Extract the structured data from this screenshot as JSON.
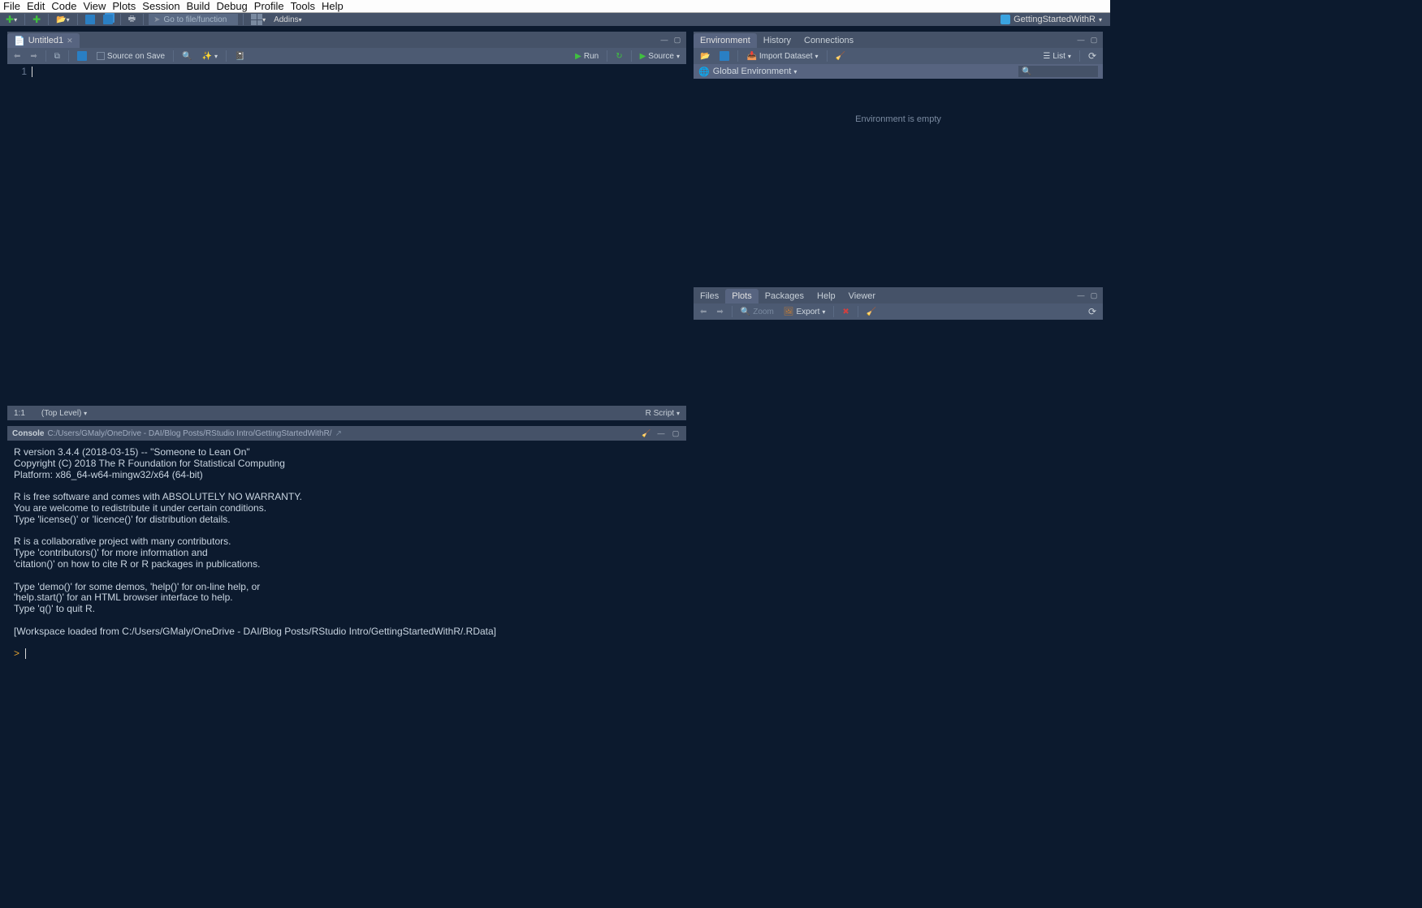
{
  "menubar": [
    "File",
    "Edit",
    "Code",
    "View",
    "Plots",
    "Session",
    "Build",
    "Debug",
    "Profile",
    "Tools",
    "Help"
  ],
  "toolbar": {
    "gofn": "Go to file/function",
    "addins": "Addins",
    "project": "GettingStartedWithR"
  },
  "source": {
    "tab": "Untitled1",
    "source_on_save": "Source on Save",
    "run": "Run",
    "source_btn": "Source",
    "line_no": "1",
    "status_pos": "1:1",
    "status_scope": "(Top Level)",
    "status_type": "R Script"
  },
  "console": {
    "title": "Console",
    "path": "C:/Users/GMaly/OneDrive - DAI/Blog Posts/RStudio Intro/GettingStartedWithR/",
    "text": "R version 3.4.4 (2018-03-15) -- \"Someone to Lean On\"\nCopyright (C) 2018 The R Foundation for Statistical Computing\nPlatform: x86_64-w64-mingw32/x64 (64-bit)\n\nR is free software and comes with ABSOLUTELY NO WARRANTY.\nYou are welcome to redistribute it under certain conditions.\nType 'license()' or 'licence()' for distribution details.\n\nR is a collaborative project with many contributors.\nType 'contributors()' for more information and\n'citation()' on how to cite R or R packages in publications.\n\nType 'demo()' for some demos, 'help()' for on-line help, or\n'help.start()' for an HTML browser interface to help.\nType 'q()' to quit R.\n\n[Workspace loaded from C:/Users/GMaly/OneDrive - DAI/Blog Posts/RStudio Intro/GettingStartedWithR/.RData]\n",
    "prompt": ">"
  },
  "env": {
    "tabs": [
      "Environment",
      "History",
      "Connections"
    ],
    "import": "Import Dataset",
    "list": "List",
    "scope": "Global Environment",
    "empty": "Environment is empty",
    "search_ph": "🔍"
  },
  "plots": {
    "tabs": [
      "Files",
      "Plots",
      "Packages",
      "Help",
      "Viewer"
    ],
    "zoom": "Zoom",
    "export": "Export"
  }
}
